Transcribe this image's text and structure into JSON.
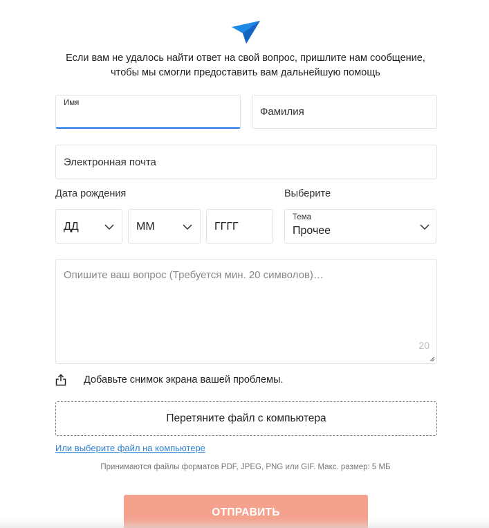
{
  "header": {
    "logo_icon": "paper-plane-icon",
    "intro_line1": "Если вам не удалось найти ответ на свой вопрос, пришлите нам сообщение,",
    "intro_line2": "чтобы мы смогли предоставить вам дальнейшую помощь"
  },
  "form": {
    "first_name": {
      "label": "Имя",
      "value": ""
    },
    "last_name": {
      "placeholder": "Фамилия"
    },
    "email": {
      "placeholder": "Электронная почта"
    },
    "dob": {
      "label": "Дата рождения",
      "day": "ДД",
      "month": "ММ",
      "year": "ГГГГ"
    },
    "topic": {
      "section_label": "Выберите",
      "label": "Тема",
      "selected": "Прочее"
    },
    "question": {
      "placeholder": "Опишите ваш вопрос (Требуется мин. 20 символов)…",
      "counter": "20"
    },
    "upload": {
      "icon": "share-upload-icon",
      "text": "Добавьте снимок экрана вашей проблемы.",
      "dropzone": "Перетяните файл с компьютера",
      "pick_link": "Или выберите файл на компьютере",
      "formats_note": "Принимаются файлы форматов PDF, JPEG, PNG или GIF. Макс. размер: 5 МБ"
    },
    "submit_label": "ОТПРАВИТЬ"
  },
  "colors": {
    "accent_blue": "#1a73e8",
    "link": "#2b7fd4",
    "submit_bg": "#f4a28e"
  }
}
